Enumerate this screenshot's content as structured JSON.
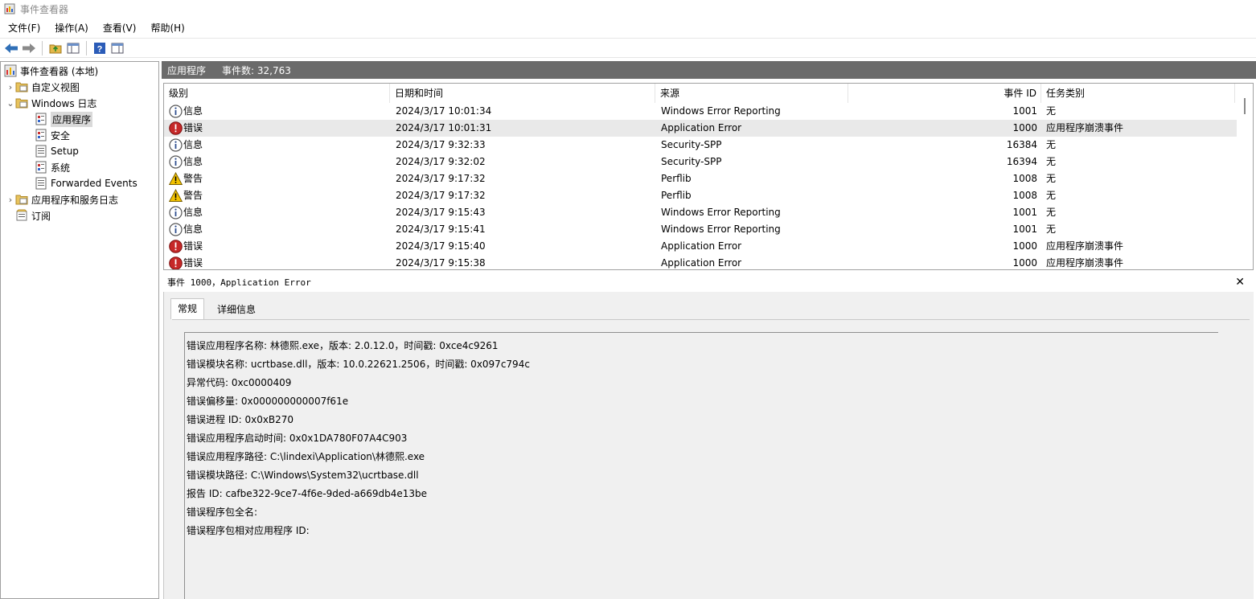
{
  "window": {
    "title": "事件查看器"
  },
  "menu": [
    {
      "label": "文件(F)"
    },
    {
      "label": "操作(A)"
    },
    {
      "label": "查看(V)"
    },
    {
      "label": "帮助(H)"
    }
  ],
  "tree": {
    "root": "事件查看器 (本地)",
    "custom_views": "自定义视图",
    "windows_logs": "Windows 日志",
    "logs": [
      "应用程序",
      "安全",
      "Setup",
      "系统",
      "Forwarded Events"
    ],
    "app_service_logs": "应用程序和服务日志",
    "subscriptions": "订阅"
  },
  "header": {
    "title": "应用程序",
    "count_label": "事件数: 32,763"
  },
  "columns": {
    "level": "级别",
    "datetime": "日期和时间",
    "source": "来源",
    "event_id": "事件 ID",
    "task": "任务类别"
  },
  "events": [
    {
      "level": "信息",
      "type": "info",
      "datetime": "2024/3/17 10:01:34",
      "source": "Windows Error Reporting",
      "event_id": "1001",
      "task": "无"
    },
    {
      "level": "错误",
      "type": "error",
      "datetime": "2024/3/17 10:01:31",
      "source": "Application Error",
      "event_id": "1000",
      "task": "应用程序崩溃事件"
    },
    {
      "level": "信息",
      "type": "info",
      "datetime": "2024/3/17 9:32:33",
      "source": "Security-SPP",
      "event_id": "16384",
      "task": "无"
    },
    {
      "level": "信息",
      "type": "info",
      "datetime": "2024/3/17 9:32:02",
      "source": "Security-SPP",
      "event_id": "16394",
      "task": "无"
    },
    {
      "level": "警告",
      "type": "warning",
      "datetime": "2024/3/17 9:17:32",
      "source": "Perflib",
      "event_id": "1008",
      "task": "无"
    },
    {
      "level": "警告",
      "type": "warning",
      "datetime": "2024/3/17 9:17:32",
      "source": "Perflib",
      "event_id": "1008",
      "task": "无"
    },
    {
      "level": "信息",
      "type": "info",
      "datetime": "2024/3/17 9:15:43",
      "source": "Windows Error Reporting",
      "event_id": "1001",
      "task": "无"
    },
    {
      "level": "信息",
      "type": "info",
      "datetime": "2024/3/17 9:15:41",
      "source": "Windows Error Reporting",
      "event_id": "1001",
      "task": "无"
    },
    {
      "level": "错误",
      "type": "error",
      "datetime": "2024/3/17 9:15:40",
      "source": "Application Error",
      "event_id": "1000",
      "task": "应用程序崩溃事件"
    },
    {
      "level": "错误",
      "type": "error",
      "datetime": "2024/3/17 9:15:38",
      "source": "Application Error",
      "event_id": "1000",
      "task": "应用程序崩溃事件"
    }
  ],
  "detail": {
    "title": "事件 1000，Application Error",
    "tabs": [
      "常规",
      "详细信息"
    ],
    "lines": [
      "错误应用程序名称: 林德熙.exe，版本: 2.0.12.0，时间戳: 0xce4c9261",
      "错误模块名称: ucrtbase.dll，版本: 10.0.22621.2506，时间戳: 0x097c794c",
      "异常代码: 0xc0000409",
      "错误偏移量: 0x000000000007f61e",
      "错误进程 ID: 0x0xB270",
      "错误应用程序启动时间: 0x0x1DA780F07A4C903",
      "错误应用程序路径: C:\\lindexi\\Application\\林德熙.exe",
      "错误模块路径: C:\\Windows\\System32\\ucrtbase.dll",
      "报告 ID: cafbe322-9ce7-4f6e-9ded-a669db4e13be",
      "错误程序包全名:",
      "错误程序包相对应用程序 ID:"
    ]
  },
  "colors": {
    "header_bg": "#6b6b6b",
    "info": "#3b5fa8",
    "error": "#c62828",
    "warning": "#f2c200"
  }
}
